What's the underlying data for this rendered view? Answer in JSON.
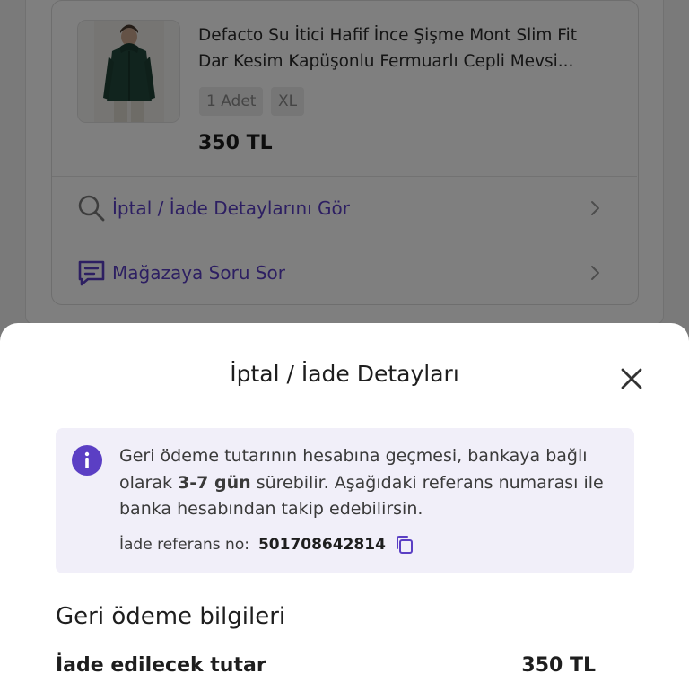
{
  "product": {
    "title_line1": "Defacto Su İtici Hafif İnce Şişme Mont Slim Fit",
    "title_line2": "Dar Kesim Kapüşonlu Fermuarlı Cepli Mevsi...",
    "quantity": "1 Adet",
    "size": "XL",
    "price": "350 TL"
  },
  "actions": {
    "details_label": "İptal / İade Detaylarını Gör",
    "ask_label": "Mağazaya Soru Sor"
  },
  "sheet": {
    "title": "İptal / İade Detayları",
    "info": {
      "text_before": "Geri ödeme tutarının hesabına geçmesi, bankaya bağlı olarak ",
      "text_bold": "3-7 gün",
      "text_after": " sürebilir. Aşağıdaki referans numarası ile banka hesabından takip edebilirsin.",
      "ref_label": "İade referans no:",
      "ref_value": "501708642814"
    },
    "section_title": "Geri ödeme bilgileri",
    "refund_label": "İade edilecek tutar",
    "refund_value": "350 TL"
  },
  "colors": {
    "accent": "#5b3fc4",
    "info_bg": "#f1eff9",
    "overlay": "rgba(0,0,0,0.5)"
  },
  "icons": {
    "details": "search-icon",
    "ask": "chat-bubble-icon",
    "chevron": "chevron-right-icon",
    "close": "close-icon",
    "info": "info-icon",
    "copy": "copy-icon"
  }
}
